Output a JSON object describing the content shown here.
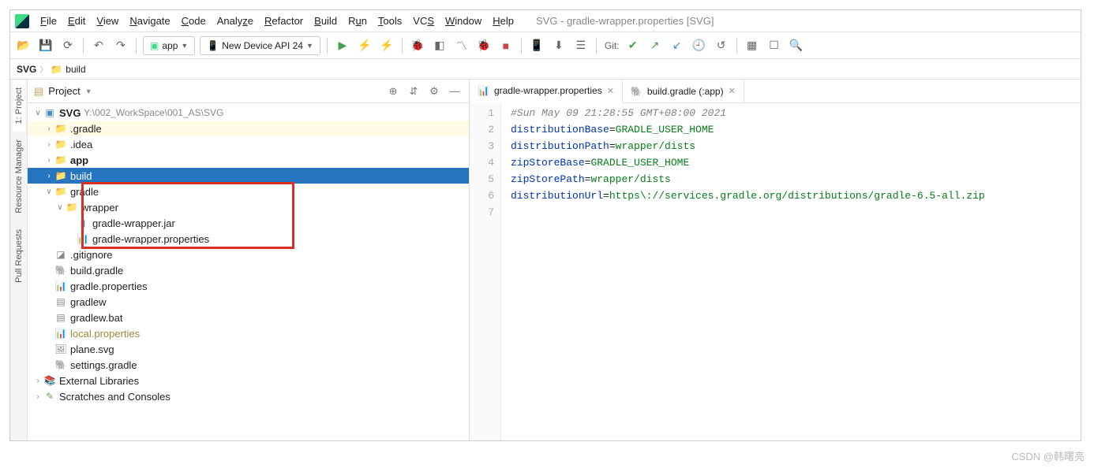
{
  "menu": {
    "items": [
      "File",
      "Edit",
      "View",
      "Navigate",
      "Code",
      "Analyze",
      "Refactor",
      "Build",
      "Run",
      "Tools",
      "VCS",
      "Window",
      "Help"
    ]
  },
  "window_title": "SVG - gradle-wrapper.properties [SVG]",
  "toolbar": {
    "module": "app",
    "device": "New Device API 24",
    "git_label": "Git:"
  },
  "breadcrumb": {
    "root": "SVG",
    "folder": "build"
  },
  "panel": {
    "title": "Project",
    "view_mode": "Project"
  },
  "tree": {
    "root": {
      "name": "SVG",
      "path": "Y:\\002_WorkSpace\\001_AS\\SVG"
    },
    "gradle_dir": ".gradle",
    "idea_dir": ".idea",
    "app_dir": "app",
    "build_dir": "build",
    "gradle_folder": "gradle",
    "wrapper_folder": "wrapper",
    "wrapper_jar": "gradle-wrapper.jar",
    "wrapper_props": "gradle-wrapper.properties",
    "gitignore": ".gitignore",
    "build_gradle": "build.gradle",
    "gradle_props": "gradle.properties",
    "gradlew": "gradlew",
    "gradlew_bat": "gradlew.bat",
    "local_props": "local.properties",
    "plane": "plane.svg",
    "settings": "settings.gradle",
    "ext_libs": "External Libraries",
    "scratches": "Scratches and Consoles"
  },
  "editor": {
    "tab1": "gradle-wrapper.properties",
    "tab2": "build.gradle (:app)",
    "lines": {
      "l1": "#Sun May 09 21:28:55 GMT+08:00 2021",
      "l2k": "distributionBase",
      "l2v": "GRADLE_USER_HOME",
      "l3k": "distributionPath",
      "l3v": "wrapper/dists",
      "l4k": "zipStoreBase",
      "l4v": "GRADLE_USER_HOME",
      "l5k": "zipStorePath",
      "l5v": "wrapper/dists",
      "l6k": "distributionUrl",
      "l6v": "https\\://services.gradle.org/distributions/gradle-6.5-all.zip"
    }
  },
  "side_tabs": {
    "project": "1: Project",
    "res": "Resource Manager",
    "pull": "Pull Requests"
  },
  "watermark": "CSDN @韩曙亮"
}
